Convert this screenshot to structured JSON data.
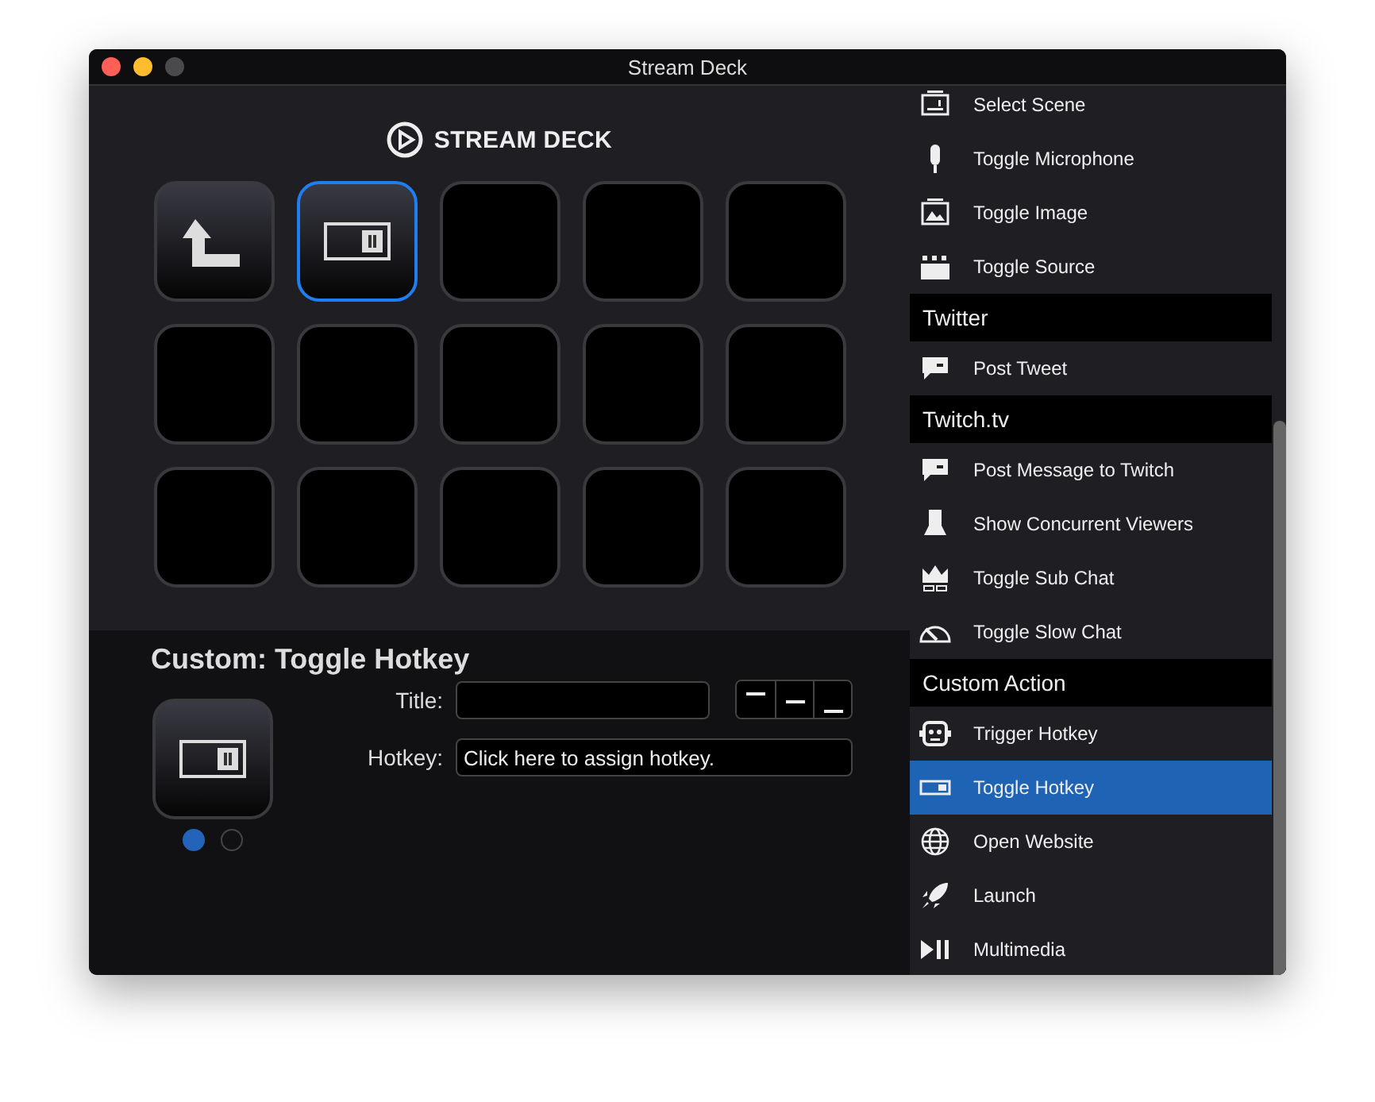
{
  "window": {
    "title": "Stream Deck"
  },
  "logo": {
    "text": "STREAM DECK"
  },
  "keys": [
    {
      "kind": "back",
      "selected": false
    },
    {
      "kind": "toggle",
      "selected": true
    },
    {
      "kind": "empty",
      "selected": false
    },
    {
      "kind": "empty",
      "selected": false
    },
    {
      "kind": "empty",
      "selected": false
    },
    {
      "kind": "empty",
      "selected": false
    },
    {
      "kind": "empty",
      "selected": false
    },
    {
      "kind": "empty",
      "selected": false
    },
    {
      "kind": "empty",
      "selected": false
    },
    {
      "kind": "empty",
      "selected": false
    },
    {
      "kind": "empty",
      "selected": false
    },
    {
      "kind": "empty",
      "selected": false
    },
    {
      "kind": "empty",
      "selected": false
    },
    {
      "kind": "empty",
      "selected": false
    },
    {
      "kind": "empty",
      "selected": false
    }
  ],
  "inspector": {
    "heading": "Custom: Toggle Hotkey",
    "title_label": "Title:",
    "alignment": [
      {
        "kind": "top",
        "selected": false
      },
      {
        "kind": "middle",
        "selected": false
      },
      {
        "kind": "bottom",
        "selected": false
      }
    ],
    "hotkey_label": "Hotkey:",
    "hotkey_value": "Click here to assign hotkey.",
    "states": [
      {
        "selected": true
      },
      {
        "selected": false
      }
    ]
  },
  "actions": [
    {
      "items": [
        {
          "kind": "scene",
          "label": "Select Scene",
          "selected": false
        },
        {
          "kind": "microphone",
          "label": "Toggle Microphone",
          "selected": false
        },
        {
          "kind": "image",
          "label": "Toggle Image",
          "selected": false
        },
        {
          "kind": "source",
          "label": "Toggle Source",
          "selected": false
        }
      ]
    },
    {
      "header": "Twitter",
      "items": [
        {
          "kind": "speech",
          "label": "Post Tweet",
          "selected": false
        }
      ]
    },
    {
      "header": "Twitch.tv",
      "items": [
        {
          "kind": "speech",
          "label": "Post Message to Twitch",
          "selected": false
        },
        {
          "kind": "viewers",
          "label": "Show Concurrent Viewers",
          "selected": false
        },
        {
          "kind": "crown",
          "label": "Toggle Sub Chat",
          "selected": false
        },
        {
          "kind": "gauge",
          "label": "Toggle Slow Chat",
          "selected": false
        }
      ]
    },
    {
      "header": "Custom Action",
      "items": [
        {
          "kind": "robot",
          "label": "Trigger Hotkey",
          "selected": false
        },
        {
          "kind": "toggle",
          "label": "Toggle Hotkey",
          "selected": true
        },
        {
          "kind": "globe",
          "label": "Open Website",
          "selected": false
        },
        {
          "kind": "rocket",
          "label": "Launch",
          "selected": false
        },
        {
          "kind": "media",
          "label": "Multimedia",
          "selected": false
        }
      ]
    }
  ]
}
